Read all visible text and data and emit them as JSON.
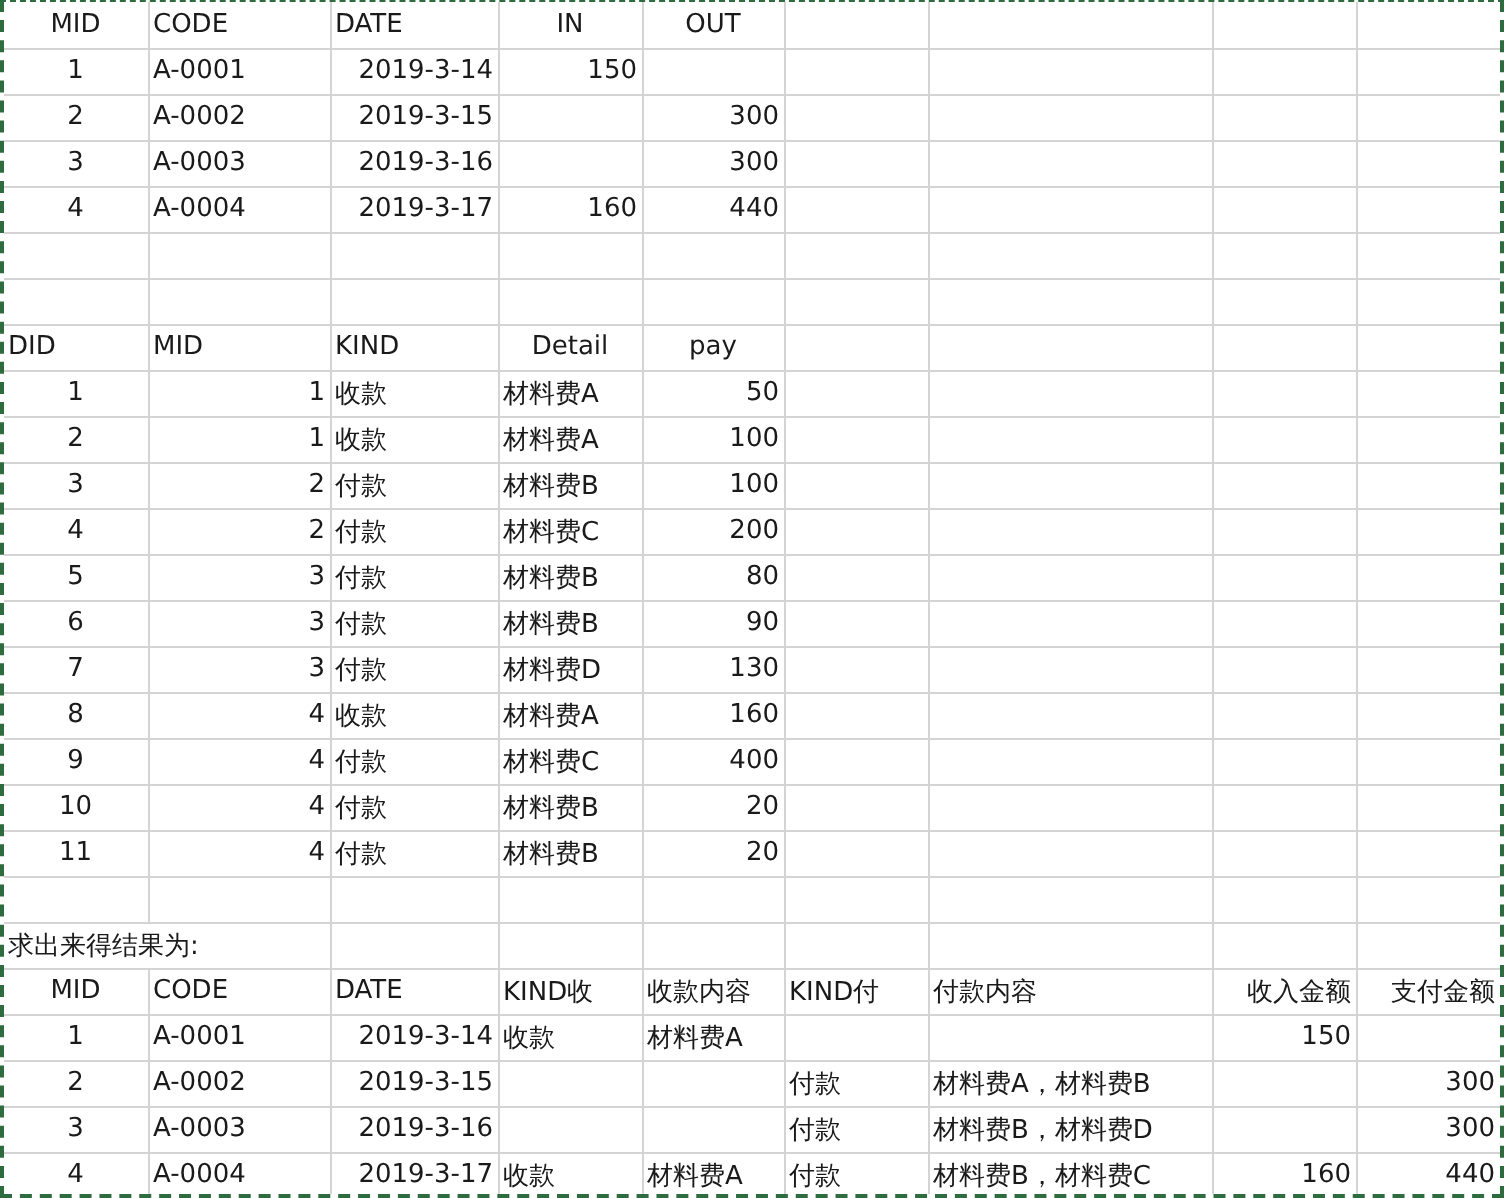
{
  "sheet": {
    "sections": [
      {
        "columns": [
          "MID",
          "CODE",
          "DATE",
          "IN",
          "OUT"
        ],
        "rows": [
          [
            "1",
            "A-0001",
            "2019-3-14",
            "150",
            null
          ],
          [
            "2",
            "A-0002",
            "2019-3-15",
            null,
            "300"
          ],
          [
            "3",
            "A-0003",
            "2019-3-16",
            null,
            "300"
          ],
          [
            "4",
            "A-0004",
            "2019-3-17",
            "160",
            "440"
          ]
        ]
      },
      {
        "columns": [
          "DID",
          "MID",
          "KIND",
          "Detail",
          "pay"
        ],
        "rows": [
          [
            "1",
            "1",
            "收款",
            "材料费A",
            "50"
          ],
          [
            "2",
            "1",
            "收款",
            "材料费A",
            "100"
          ],
          [
            "3",
            "2",
            "付款",
            "材料费B",
            "100"
          ],
          [
            "4",
            "2",
            "付款",
            "材料费C",
            "200"
          ],
          [
            "5",
            "3",
            "付款",
            "材料费B",
            "80"
          ],
          [
            "6",
            "3",
            "付款",
            "材料费B",
            "90"
          ],
          [
            "7",
            "3",
            "付款",
            "材料费D",
            "130"
          ],
          [
            "8",
            "4",
            "收款",
            "材料费A",
            "160"
          ],
          [
            "9",
            "4",
            "付款",
            "材料费C",
            "400"
          ],
          [
            "10",
            "4",
            "付款",
            "材料费B",
            "20"
          ],
          [
            "11",
            "4",
            "付款",
            "材料费B",
            "20"
          ]
        ]
      },
      {
        "note": "求出来得结果为:",
        "columns": [
          "MID",
          "CODE",
          "DATE",
          "KIND收",
          "收款内容",
          "KIND付",
          "付款内容",
          "收入金额",
          "支付金额"
        ],
        "rows": [
          [
            "1",
            "A-0001",
            "2019-3-14",
            "收款",
            "材料费A",
            null,
            null,
            "150",
            null
          ],
          [
            "2",
            "A-0002",
            "2019-3-15",
            null,
            null,
            "付款",
            "材料费A，材料费B",
            null,
            "300"
          ],
          [
            "3",
            "A-0003",
            "2019-3-16",
            null,
            null,
            "付款",
            "材料费B，材料费D",
            null,
            "300"
          ],
          [
            "4",
            "A-0004",
            "2019-3-17",
            "收款",
            "材料费A",
            "付款",
            "材料费B，材料费C",
            "160",
            "440"
          ]
        ]
      }
    ]
  }
}
